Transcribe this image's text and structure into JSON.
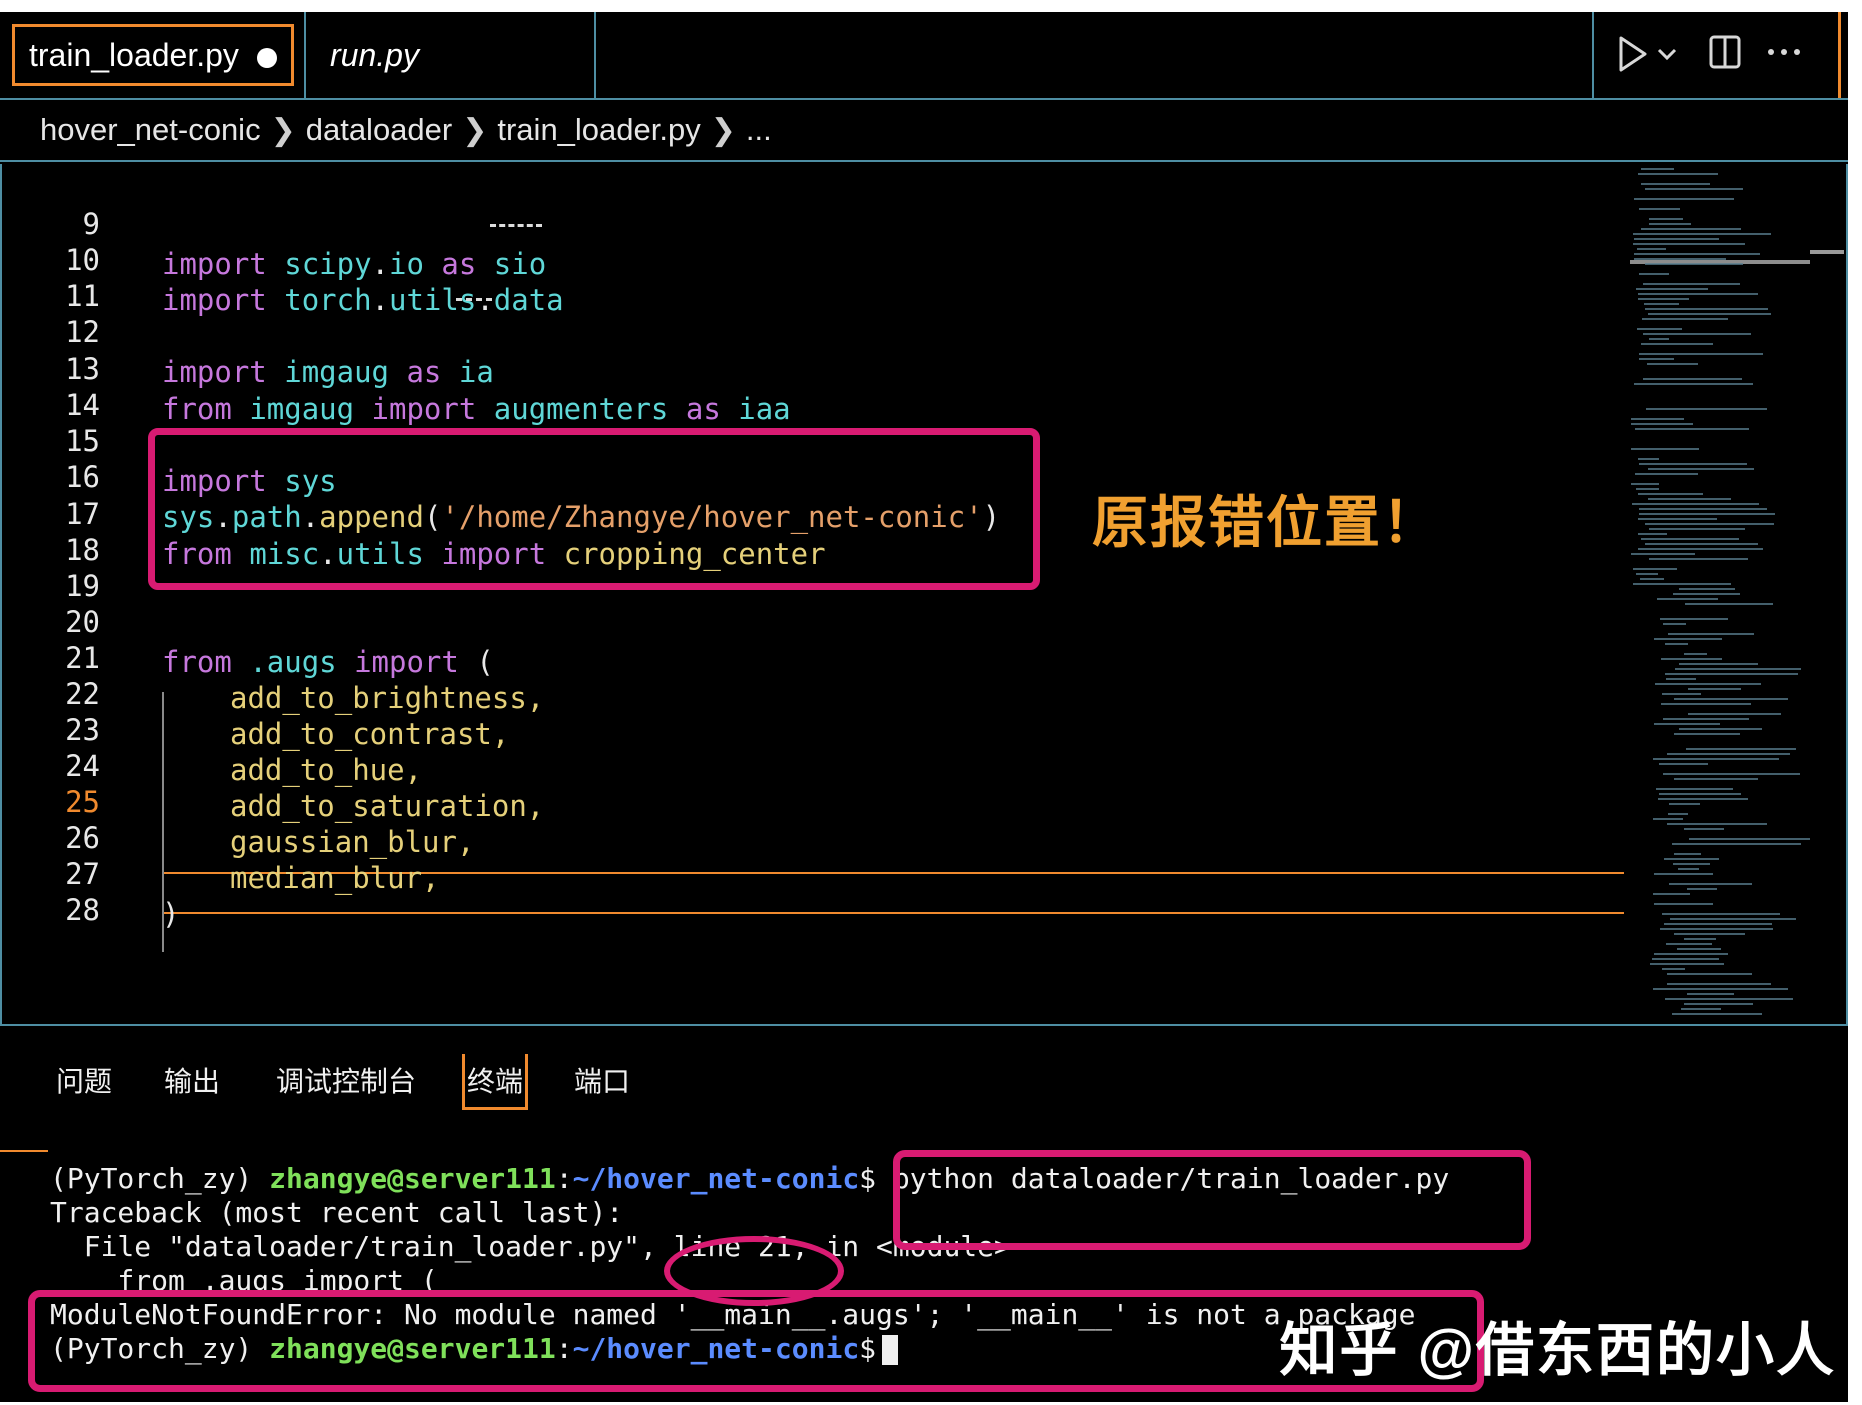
{
  "tabs": [
    {
      "label": "train_loader.py",
      "modified": true,
      "active": true
    },
    {
      "label": "run.py",
      "italic": true
    }
  ],
  "tab_actions": {
    "run_icon": "play-icon",
    "dropdown_icon": "chevron-down-icon",
    "split_icon": "split-editor-icon",
    "more_icon": "more-icon"
  },
  "breadcrumb": {
    "segments": [
      "hover_net-conic",
      "dataloader",
      "train_loader.py",
      "..."
    ]
  },
  "editor": {
    "current_line": 25,
    "lines": [
      {
        "n": "9"
      },
      {
        "n": "10"
      },
      {
        "n": "11"
      },
      {
        "n": "12"
      },
      {
        "n": "13"
      },
      {
        "n": "14"
      },
      {
        "n": "15"
      },
      {
        "n": "16"
      },
      {
        "n": "17"
      },
      {
        "n": "18"
      },
      {
        "n": "19"
      },
      {
        "n": "20"
      },
      {
        "n": "21"
      },
      {
        "n": "22"
      },
      {
        "n": "23"
      },
      {
        "n": "24"
      },
      {
        "n": "25"
      },
      {
        "n": "26"
      },
      {
        "n": "27"
      },
      {
        "n": "28"
      }
    ],
    "code": {
      "l9": [
        "import",
        "scipy",
        ".",
        "io",
        "as",
        "sio"
      ],
      "l10": [
        "import",
        "torch",
        ".",
        "utils",
        ".",
        "data"
      ],
      "l12": [
        "import",
        "imgaug",
        "as",
        "ia"
      ],
      "l13": [
        "from",
        "imgaug",
        "import",
        "augmenters",
        "as",
        "iaa"
      ],
      "l15": [
        "import",
        "sys"
      ],
      "l16": [
        "sys",
        ".",
        "path",
        ".",
        "append",
        "(",
        "'/home/Zhangye/hover_net-conic'",
        ")"
      ],
      "l17": [
        "from",
        "misc",
        ".",
        "utils",
        "import",
        "cropping_center"
      ],
      "l20": [
        "from",
        ".augs",
        "import",
        "("
      ],
      "l21": "add_to_brightness,",
      "l22": "add_to_contrast,",
      "l23": "add_to_hue,",
      "l24": "add_to_saturation,",
      "l25": "gaussian_blur,",
      "l26": "median_blur,",
      "l27": ")"
    },
    "annotation": "原报错位置！"
  },
  "panel": {
    "tabs": [
      "问题",
      "输出",
      "调试控制台",
      "终端",
      "端口"
    ],
    "active_tab": "终端"
  },
  "terminal": {
    "env": "(PyTorch_zy)",
    "user": "zhangye@server111",
    "path": "~/hover_net-conic",
    "prompt_symbol": "$",
    "command": "python dataloader/train_loader.py",
    "traceback": "Traceback (most recent call last):",
    "file_line": "  File \"dataloader/train_loader.py\", line 21, in <module>",
    "code_line": "    from .augs import (",
    "error": "ModuleNotFoundError: No module named '__main__.augs'; '__main__' is not a package"
  },
  "watermark": "知乎 @借东西的小人",
  "colors": {
    "accent": "#f08a2e",
    "highlight": "#d81b72",
    "keyword": "#c678dd",
    "module": "#5fd7d7",
    "identifier": "#e5d07a",
    "annotation": "#f0a030"
  }
}
